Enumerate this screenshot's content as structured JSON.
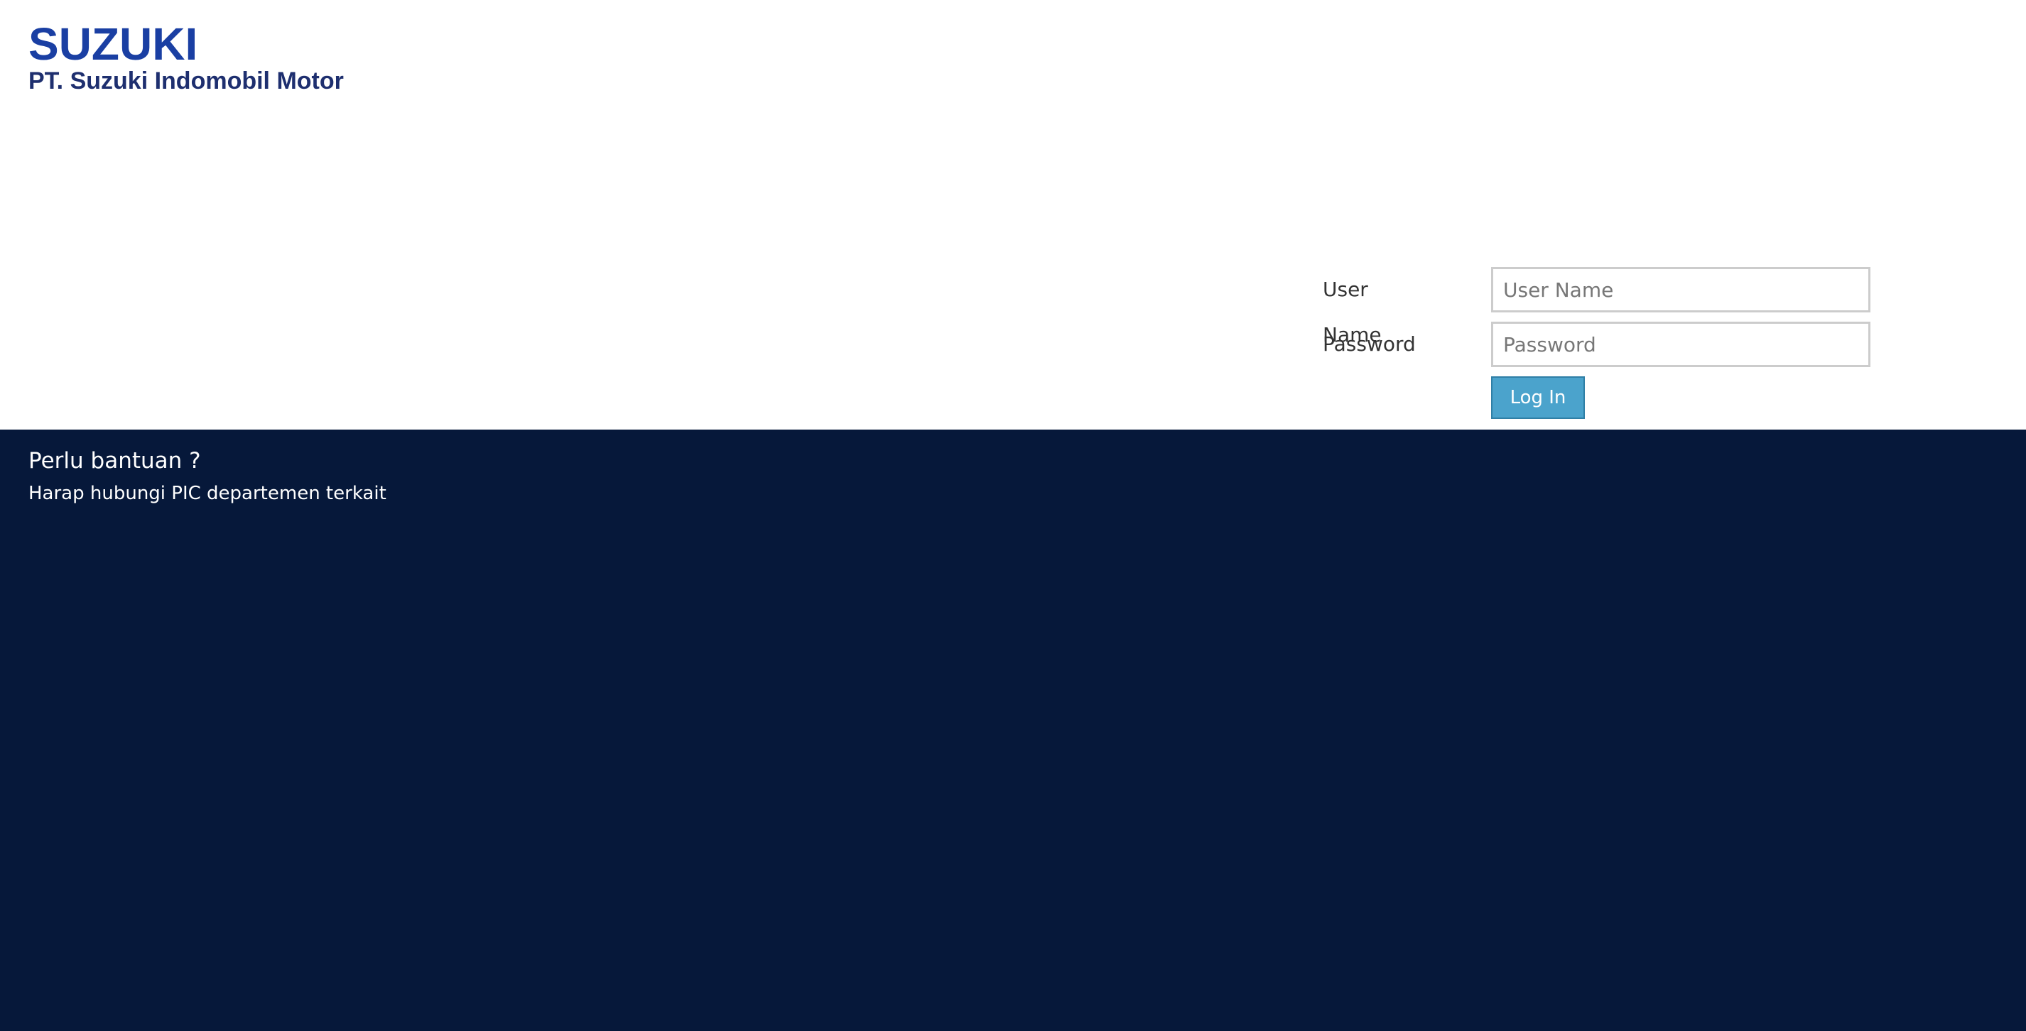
{
  "brand": {
    "name": "SUZUKI",
    "company": "PT. Suzuki Indomobil Motor"
  },
  "login": {
    "username_label": "User Name",
    "username_placeholder": "User Name",
    "username_value": "",
    "password_label": "Password",
    "password_placeholder": "Password",
    "password_value": "",
    "submit_label": "Log In"
  },
  "footer": {
    "help_title": "Perlu bantuan ?",
    "help_text": "Harap hubungi PIC departemen terkait"
  },
  "colors": {
    "brand_blue": "#1a3fa3",
    "company_blue": "#1e2f6f",
    "button_blue": "#4ba3cc",
    "footer_navy": "#06183a"
  }
}
